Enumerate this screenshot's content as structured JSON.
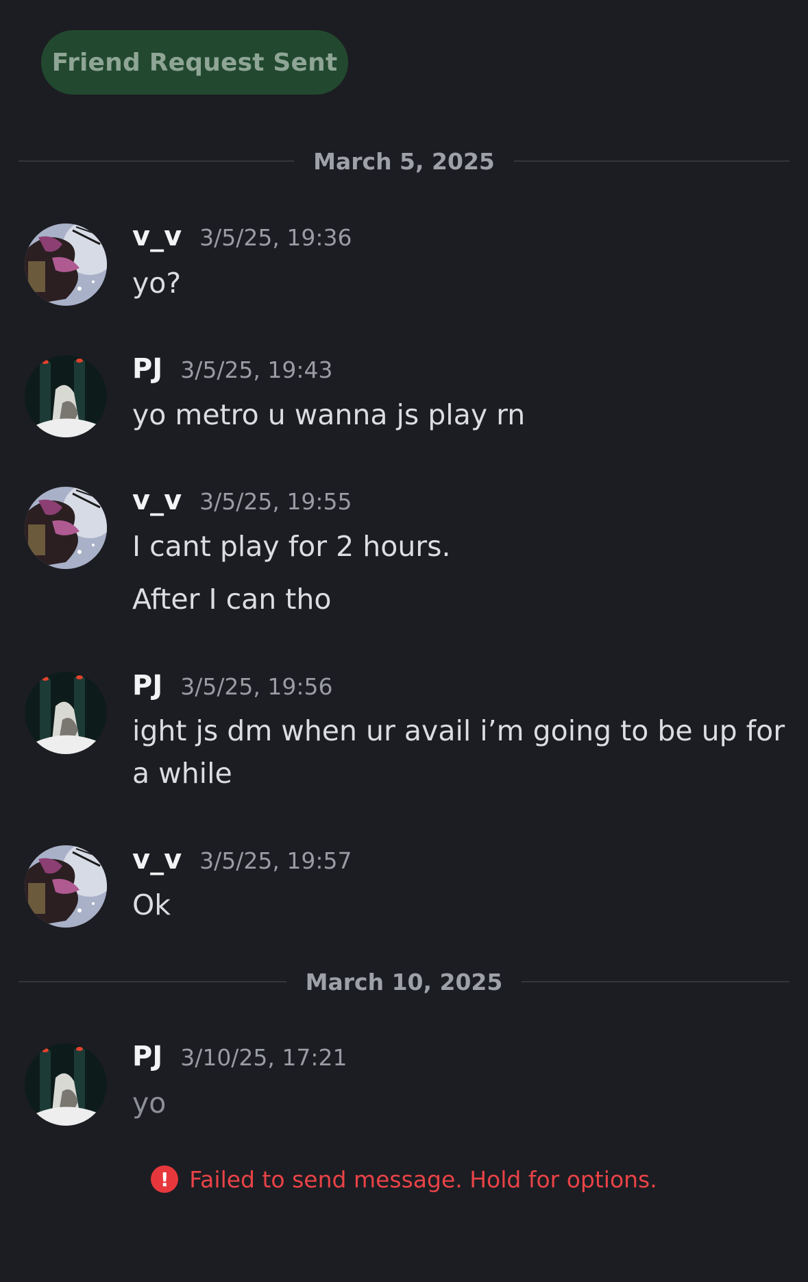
{
  "friend_request": {
    "label": "Friend Request Sent"
  },
  "dividers": [
    {
      "label": "March 5, 2025"
    },
    {
      "label": "March 10, 2025"
    }
  ],
  "messages": [
    {
      "user": "v_v",
      "time": "3/5/25, 19:36",
      "lines": [
        "yo?"
      ]
    },
    {
      "user": "PJ",
      "time": "3/5/25, 19:43",
      "lines": [
        "yo metro u wanna js play rn"
      ]
    },
    {
      "user": "v_v",
      "time": "3/5/25, 19:55",
      "lines": [
        "I cant play for 2 hours.",
        "After I can tho"
      ]
    },
    {
      "user": "PJ",
      "time": "3/5/25, 19:56",
      "lines": [
        "ight js dm when ur avail i’m going to be up for a while"
      ]
    },
    {
      "user": "v_v",
      "time": "3/5/25, 19:57",
      "lines": [
        "Ok"
      ]
    },
    {
      "user": "PJ",
      "time": "3/10/25, 17:21",
      "lines": [
        "yo"
      ],
      "status": "failed"
    }
  ],
  "error": {
    "icon": "error-icon",
    "text": "Failed to send message. Hold for options."
  },
  "colors": {
    "background": "#1c1d22",
    "friend_button": "#22492f",
    "error": "#ea4347"
  }
}
